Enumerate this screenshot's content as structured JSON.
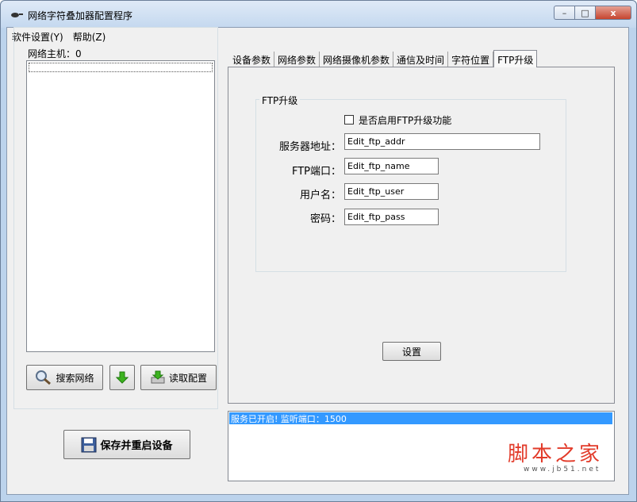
{
  "window": {
    "title": "网络字符叠加器配置程序",
    "min_label": "–",
    "max_label": "□",
    "close_label": "x"
  },
  "menu": [
    {
      "label": "软件设置(Y)"
    },
    {
      "label": "帮助(Z)"
    }
  ],
  "left_panel": {
    "group_label": "网络主机：0",
    "search_button": "搜索网络",
    "read_config_button": "读取配置",
    "save_restart_button": "保存并重启设备"
  },
  "tabs": [
    {
      "label": "设备参数"
    },
    {
      "label": "网络参数"
    },
    {
      "label": "网络摄像机参数"
    },
    {
      "label": "通信及时间"
    },
    {
      "label": "字符位置"
    },
    {
      "label": "FTP升级"
    }
  ],
  "ftp": {
    "group_label": "FTP升级",
    "enable_label": "是否启用FTP升级功能",
    "enable_checked": false,
    "server_label": "服务器地址：",
    "server_value": "Edit_ftp_addr",
    "port_label": "FTP端口：",
    "port_value": "Edit_ftp_name",
    "user_label": "用户名：",
    "user_value": "Edit_ftp_user",
    "pass_label": "密码：",
    "pass_value": "Edit_ftp_pass",
    "set_button": "设置"
  },
  "status": {
    "line": "服务已开启! 监听端口：1500"
  },
  "watermark": {
    "main": "脚本之家",
    "sub": "www.jb51.net"
  },
  "colors": {
    "selection": "#3399ff",
    "watermark": "#e23b2a",
    "down_arrow": "#3cb31f"
  }
}
